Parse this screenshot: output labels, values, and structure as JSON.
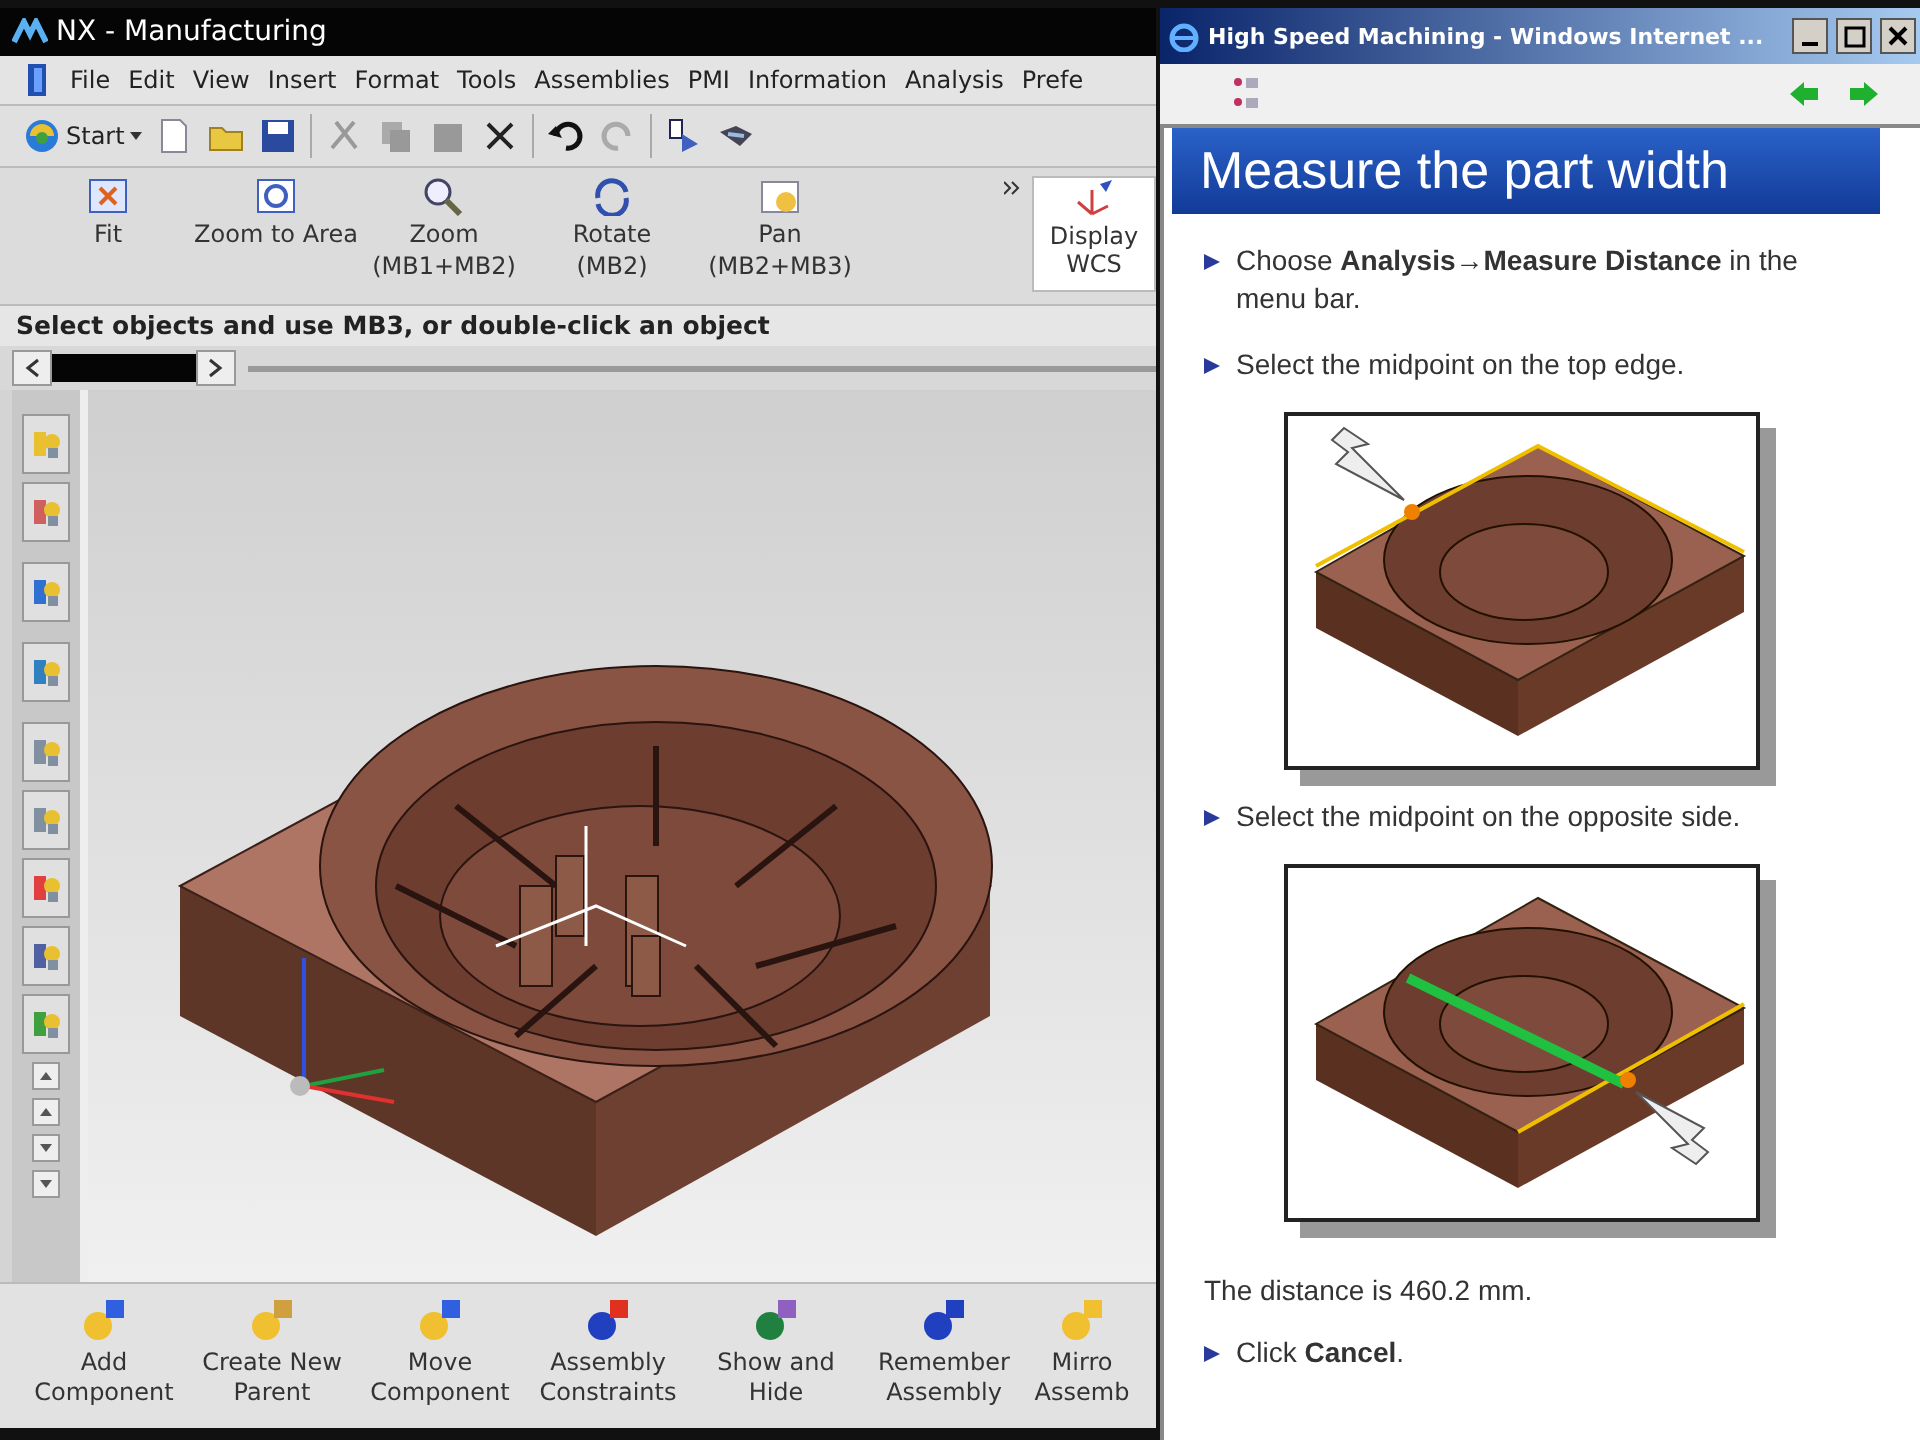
{
  "nx_window": {
    "title": "NX - Manufacturing",
    "menu": [
      {
        "label": "File"
      },
      {
        "label": "Edit"
      },
      {
        "label": "View"
      },
      {
        "label": "Insert"
      },
      {
        "label": "Format"
      },
      {
        "label": "Tools"
      },
      {
        "label": "Assemblies"
      },
      {
        "label": "PMI"
      },
      {
        "label": "Information"
      },
      {
        "label": "Analysis"
      },
      {
        "label": "Prefe"
      }
    ],
    "start_button": {
      "label": "Start"
    },
    "view_toolbar": [
      {
        "label": "Fit"
      },
      {
        "label": "Zoom to Area"
      },
      {
        "label": "Zoom",
        "hint": "(MB1+MB2)"
      },
      {
        "label": "Rotate",
        "hint": "(MB2)"
      },
      {
        "label": "Pan",
        "hint": "(MB2+MB3)"
      },
      {
        "label": "Display WCS"
      }
    ],
    "cue_line": "Select objects and use MB3, or double-click an object",
    "assembly_toolbar": [
      {
        "label": "Add Component"
      },
      {
        "label": "Create New Parent"
      },
      {
        "label": "Move Component"
      },
      {
        "label": "Assembly Constraints"
      },
      {
        "label": "Show and Hide"
      },
      {
        "label": "Remember Assembly"
      },
      {
        "label": "Mirro Assemb"
      }
    ]
  },
  "browser_window": {
    "title": "High Speed Machining - Windows Internet ...",
    "heading": "Measure the part width",
    "content": [
      {
        "kind": "step",
        "text": "Choose **Analysis→Measure Distance** in the menu bar."
      },
      {
        "kind": "step",
        "text": "Select the midpoint on the top edge."
      },
      {
        "kind": "figure"
      },
      {
        "kind": "step",
        "text": "Select the midpoint on the opposite side."
      },
      {
        "kind": "figure"
      },
      {
        "kind": "text",
        "text": "The distance is 460.2 mm."
      },
      {
        "kind": "step",
        "text": "Click **Cancel**."
      }
    ]
  }
}
